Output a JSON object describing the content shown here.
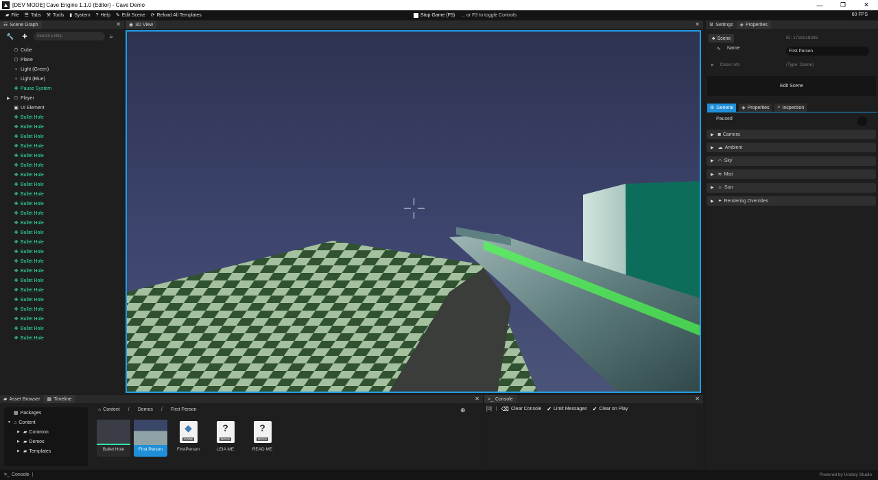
{
  "window": {
    "title": "[DEV MODE] Cave Engine 1.1.0 (Editor) - Cave Demo",
    "minimize": "—",
    "restore": "❐",
    "close": "✕"
  },
  "menubar": {
    "items": [
      {
        "label": "File",
        "icon": "folder-icon"
      },
      {
        "label": "Tabs",
        "icon": "tabs-icon"
      },
      {
        "label": "Tools",
        "icon": "tools-icon"
      },
      {
        "label": "System",
        "icon": "system-icon"
      },
      {
        "label": "Help",
        "icon": "help-icon"
      },
      {
        "label": "Edit Scene",
        "icon": "edit-icon"
      },
      {
        "label": "Reload All Templates",
        "icon": "reload-icon"
      }
    ],
    "stop_game": "Stop Game (F5)",
    "hint": "... or F3 to toggle Controls",
    "fps": "60 FPS"
  },
  "scene_graph": {
    "title": "Scene Graph",
    "search_placeholder": "Search Entity...",
    "entities": [
      {
        "label": "Cube",
        "icon": "entity-icon",
        "color": "normal",
        "expandable": false
      },
      {
        "label": "Plane",
        "icon": "entity-icon",
        "color": "normal",
        "expandable": false
      },
      {
        "label": "Light (Green)",
        "icon": "light-icon",
        "color": "normal",
        "expandable": false
      },
      {
        "label": "Light (Blue)",
        "icon": "light-icon",
        "color": "normal",
        "expandable": false
      },
      {
        "label": "Pause System",
        "icon": "template-icon",
        "color": "green",
        "expandable": false
      },
      {
        "label": "Player",
        "icon": "entity-icon",
        "color": "normal",
        "expandable": true
      },
      {
        "label": "UI Element",
        "icon": "ui-icon",
        "color": "normal",
        "expandable": false
      },
      {
        "label": "Bullet Hole",
        "icon": "template-icon",
        "color": "green",
        "expandable": false
      },
      {
        "label": "Bullet Hole",
        "icon": "template-icon",
        "color": "green",
        "expandable": false
      },
      {
        "label": "Bullet Hole",
        "icon": "template-icon",
        "color": "green",
        "expandable": false
      },
      {
        "label": "Bullet Hole",
        "icon": "template-icon",
        "color": "green",
        "expandable": false
      },
      {
        "label": "Bullet Hole",
        "icon": "template-icon",
        "color": "green",
        "expandable": false
      },
      {
        "label": "Bullet Hole",
        "icon": "template-icon",
        "color": "green",
        "expandable": false
      },
      {
        "label": "Bullet Hole",
        "icon": "template-icon",
        "color": "green",
        "expandable": false
      },
      {
        "label": "Bullet Hole",
        "icon": "template-icon",
        "color": "green",
        "expandable": false
      },
      {
        "label": "Bullet Hole",
        "icon": "template-icon",
        "color": "green",
        "expandable": false
      },
      {
        "label": "Bullet Hole",
        "icon": "template-icon",
        "color": "green",
        "expandable": false
      },
      {
        "label": "Bullet Hole",
        "icon": "template-icon",
        "color": "green",
        "expandable": false
      },
      {
        "label": "Bullet Hole",
        "icon": "template-icon",
        "color": "green",
        "expandable": false
      },
      {
        "label": "Bullet Hole",
        "icon": "template-icon",
        "color": "green",
        "expandable": false
      },
      {
        "label": "Bullet Hole",
        "icon": "template-icon",
        "color": "green",
        "expandable": false
      },
      {
        "label": "Bullet Hole",
        "icon": "template-icon",
        "color": "green",
        "expandable": false
      },
      {
        "label": "Bullet Hole",
        "icon": "template-icon",
        "color": "green",
        "expandable": false
      },
      {
        "label": "Bullet Hole",
        "icon": "template-icon",
        "color": "green",
        "expandable": false
      },
      {
        "label": "Bullet Hole",
        "icon": "template-icon",
        "color": "green",
        "expandable": false
      },
      {
        "label": "Bullet Hole",
        "icon": "template-icon",
        "color": "green",
        "expandable": false
      },
      {
        "label": "Bullet Hole",
        "icon": "template-icon",
        "color": "green",
        "expandable": false
      },
      {
        "label": "Bullet Hole",
        "icon": "template-icon",
        "color": "green",
        "expandable": false
      },
      {
        "label": "Bullet Hole",
        "icon": "template-icon",
        "color": "green",
        "expandable": false
      },
      {
        "label": "Bullet Hole",
        "icon": "template-icon",
        "color": "green",
        "expandable": false
      },
      {
        "label": "Bullet Hole",
        "icon": "template-icon",
        "color": "green",
        "expandable": false
      }
    ]
  },
  "view3d": {
    "title": "3D View"
  },
  "right_panel": {
    "tabs": [
      "Settings",
      "Properties"
    ],
    "scene_tab": "Scene",
    "scene_id": "ID: 1728218395",
    "name_label": "Name",
    "name_value": "First Person",
    "class_info": "Class Info",
    "type_label": "(Type: Scene)",
    "edit_scene": "Edit Scene",
    "sub_tabs": [
      {
        "label": "General",
        "icon": "gear-icon",
        "active": true
      },
      {
        "label": "Properties",
        "icon": "tags-icon",
        "active": false
      },
      {
        "label": "Inspection",
        "icon": "search-icon",
        "active": false
      }
    ],
    "paused_label": "Paused",
    "sections": [
      {
        "label": "Camera",
        "icon": "camera-icon"
      },
      {
        "label": "Ambient",
        "icon": "ambient-icon"
      },
      {
        "label": "Sky",
        "icon": "sky-icon"
      },
      {
        "label": "Mist",
        "icon": "mist-icon"
      },
      {
        "label": "Sun",
        "icon": "sun-icon"
      },
      {
        "label": "Rendering Overrides",
        "icon": "wand-icon"
      }
    ]
  },
  "asset_browser": {
    "tabs": [
      "Asset Browser",
      "Timeline"
    ],
    "tree": [
      {
        "label": "Packages",
        "level": 0,
        "expander": "",
        "icon": "package-icon"
      },
      {
        "label": "Content",
        "level": 0,
        "expander": "▼",
        "icon": "home-icon"
      },
      {
        "label": "Common",
        "level": 1,
        "expander": "▶",
        "icon": "folder-icon"
      },
      {
        "label": "Demos",
        "level": 1,
        "expander": "▶",
        "icon": "folder-icon"
      },
      {
        "label": "Templates",
        "level": 1,
        "expander": "▶",
        "icon": "folder-icon"
      }
    ],
    "breadcrumbs": [
      "Content",
      "Demos",
      "First Person"
    ],
    "assets": [
      {
        "label": "Bullet Hole",
        "kind": "template"
      },
      {
        "label": "First Person",
        "kind": "scene"
      },
      {
        "label": "FirstPerson",
        "kind": "code"
      },
      {
        "label": "LEIA ME",
        "kind": "docs"
      },
      {
        "label": "READ ME",
        "kind": "docs"
      }
    ],
    "code_tag": "CODE",
    "docs_tag": "DOCS"
  },
  "console": {
    "title": "Console",
    "count": "[0]",
    "pipe": "|",
    "clear": "Clear Console",
    "limit": "Limit Messages",
    "clear_on_play": "Clear on Play"
  },
  "statusbar": {
    "console": "Console",
    "powered": "Powered by Uniday Studio"
  }
}
